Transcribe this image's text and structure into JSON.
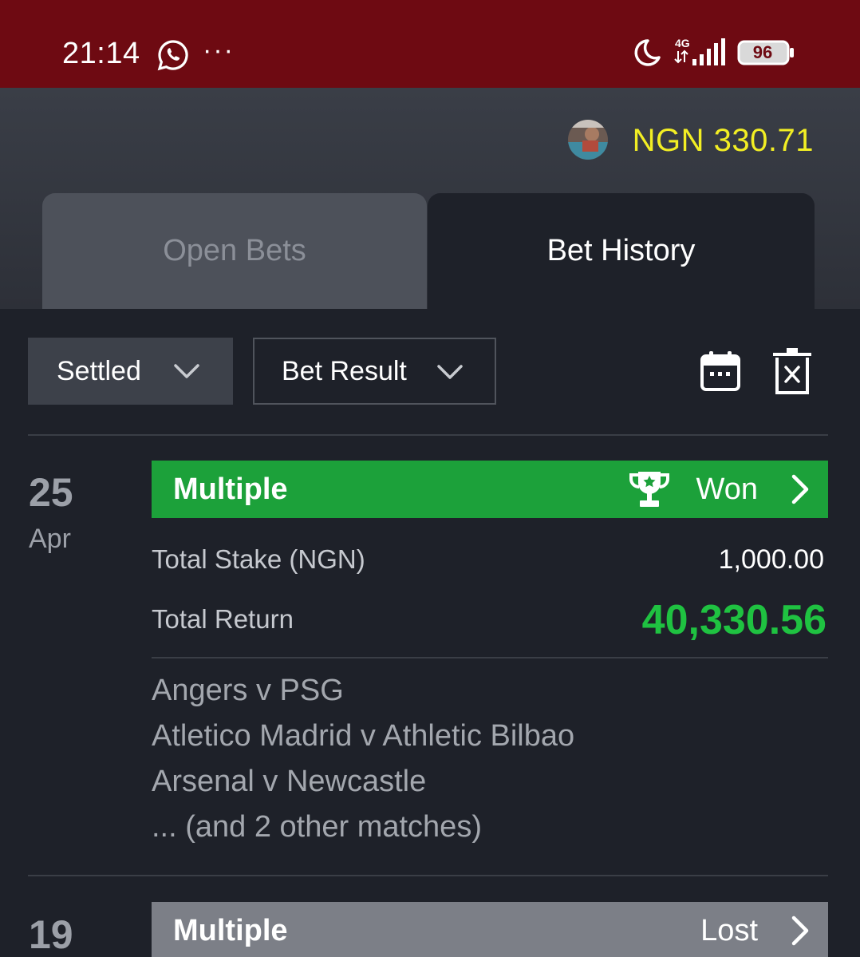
{
  "status_bar": {
    "time": "21:14",
    "dots": "···",
    "network": "4G",
    "battery": "96",
    "icons": [
      "whatsapp-icon",
      "moon-icon",
      "signal-icon",
      "battery-icon"
    ]
  },
  "header": {
    "balance": "NGN 330.71",
    "balance_color": "#f2ee24"
  },
  "tabs": [
    {
      "label": "Open Bets",
      "active": false
    },
    {
      "label": "Bet History",
      "active": true
    }
  ],
  "filters": {
    "status": "Settled",
    "result": "Bet Result"
  },
  "bets": [
    {
      "day": "25",
      "month": "Apr",
      "type": "Multiple",
      "status": "Won",
      "status_color": "#1ca13a",
      "stake_label": "Total Stake (NGN)",
      "stake": "1,000.00",
      "return_label": "Total Return",
      "return": "40,330.56",
      "matches": [
        "Angers v PSG",
        "Atletico Madrid v Athletic Bilbao",
        "Arsenal v Newcastle",
        "... (and 2 other matches)"
      ]
    },
    {
      "day": "19",
      "type": "Multiple",
      "status": "Lost",
      "status_color": "#7c7f87"
    }
  ]
}
